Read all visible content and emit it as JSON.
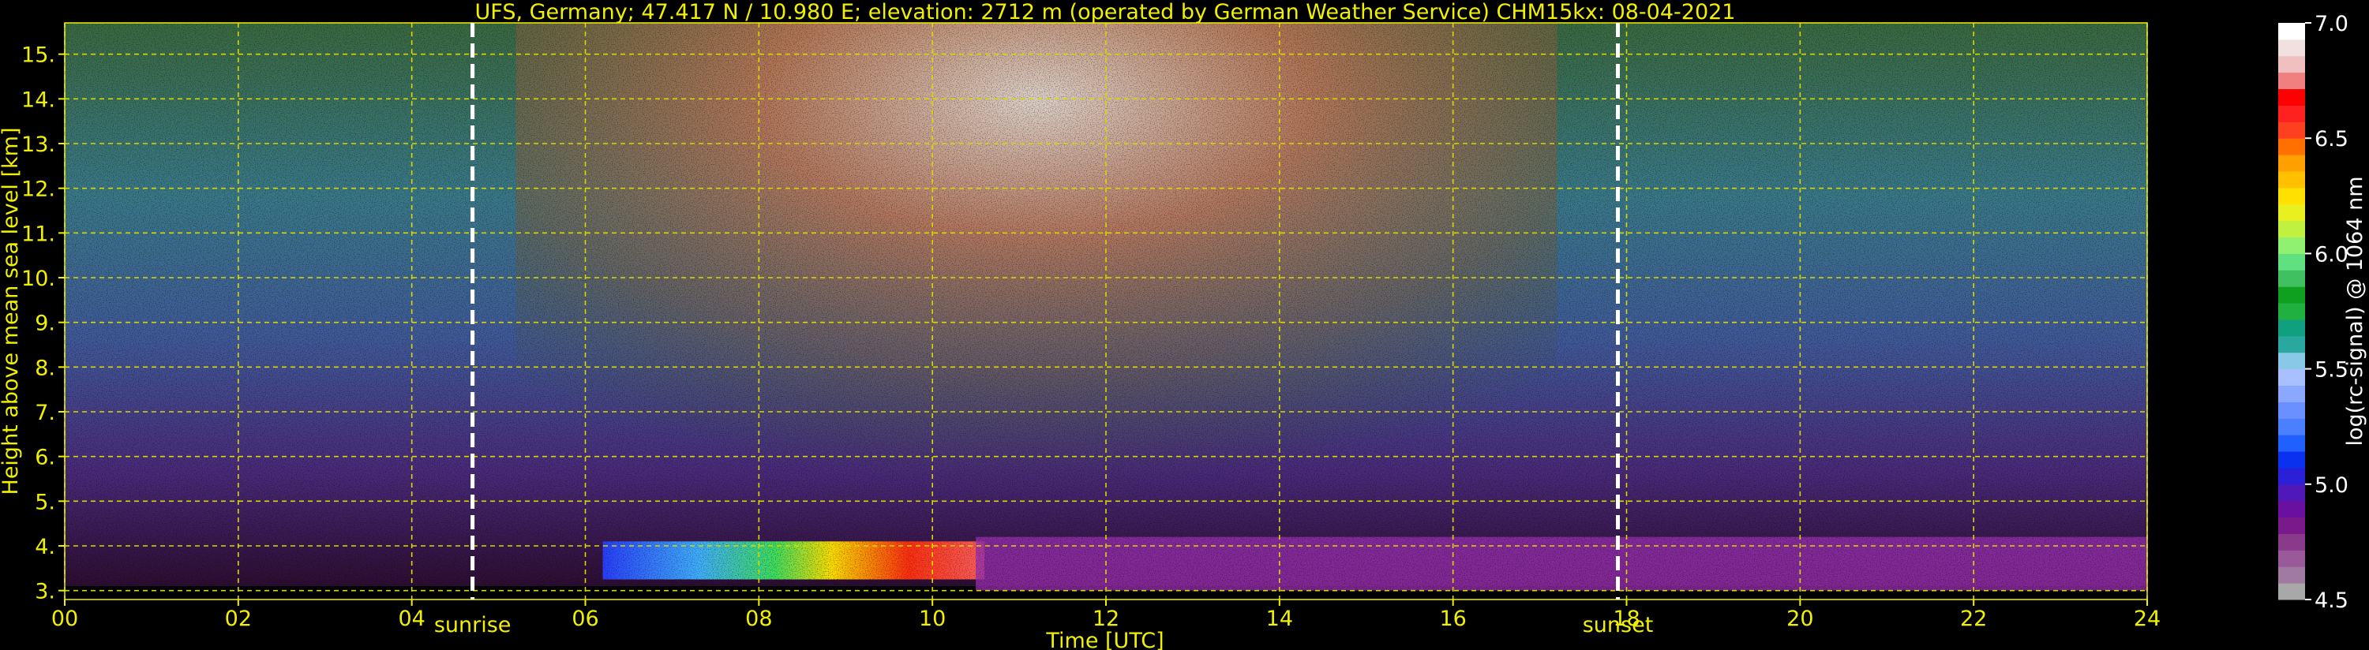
{
  "chart_data": {
    "type": "heatmap",
    "title": "UFS, Germany; 47.417 N / 10.980 E; elevation: 2712 m  (operated by German Weather Service)    CHM15kx: 08-04-2021",
    "xlabel": "Time [UTC]",
    "ylabel": "Height above mean sea level [km]",
    "xlim": [
      0,
      24
    ],
    "ylim": [
      2.8,
      15.7
    ],
    "x_ticks": [
      0,
      2,
      4,
      6,
      8,
      10,
      12,
      14,
      16,
      18,
      20,
      22,
      24
    ],
    "x_tick_labels": [
      "00",
      "02",
      "04",
      "06",
      "08",
      "10",
      "12",
      "14",
      "16",
      "18",
      "20",
      "22",
      "24"
    ],
    "y_ticks": [
      3,
      4,
      5,
      6,
      7,
      8,
      9,
      10,
      11,
      12,
      13,
      14,
      15
    ],
    "y_tick_labels": [
      "3.",
      "4.",
      "5.",
      "6.",
      "7.",
      "8.",
      "9.",
      "10.",
      "11.",
      "12.",
      "13.",
      "14.",
      "15."
    ],
    "grid": true,
    "events": [
      {
        "label": "sunrise",
        "time": 4.7
      },
      {
        "label": "sunset",
        "time": 17.9
      }
    ],
    "colorbar": {
      "label": "log(rc-signal) @ 1064 nm",
      "range": [
        4.5,
        7.0
      ],
      "tick_values": [
        4.5,
        5.0,
        5.5,
        6.0,
        6.5,
        7.0
      ],
      "tick_labels": [
        "4.5",
        "5.0",
        "5.5",
        "6.0",
        "6.5",
        "7.0"
      ],
      "colors": [
        "#a8a8a8",
        "#a07aa0",
        "#9a5a9a",
        "#8a3a8a",
        "#7a1a8a",
        "#6a10a0",
        "#5018b8",
        "#2a20d8",
        "#0a30f0",
        "#2060ff",
        "#4a80ff",
        "#6a90ff",
        "#8aa8ff",
        "#a8c0ff",
        "#8ac8e8",
        "#2aa8a0",
        "#10a080",
        "#20b040",
        "#10a020",
        "#40c060",
        "#60e080",
        "#90f070",
        "#c0f040",
        "#e8f020",
        "#ffe000",
        "#ffc000",
        "#ffa000",
        "#ff7000",
        "#ff4020",
        "#ff2020",
        "#ff0000",
        "#f08080",
        "#f0c0c0",
        "#f0e0e0",
        "#ffffff"
      ]
    },
    "colors": {
      "axis_text": "#f0f000",
      "grid": "#d8d800",
      "event_line": "#ffffff",
      "background": "#000000"
    }
  }
}
